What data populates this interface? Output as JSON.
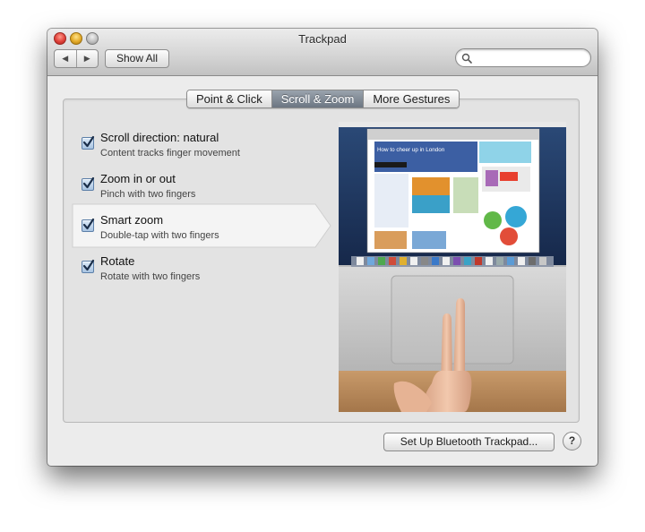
{
  "window": {
    "title": "Trackpad",
    "show_all_label": "Show All",
    "search_placeholder": ""
  },
  "tabs": [
    {
      "label": "Point & Click",
      "active": false
    },
    {
      "label": "Scroll & Zoom",
      "active": true
    },
    {
      "label": "More Gestures",
      "active": false
    }
  ],
  "options": [
    {
      "label": "Scroll direction: natural",
      "description": "Content tracks finger movement",
      "checked": true,
      "selected": false
    },
    {
      "label": "Zoom in or out",
      "description": "Pinch with two fingers",
      "checked": true,
      "selected": false
    },
    {
      "label": "Smart zoom",
      "description": "Double-tap with two fingers",
      "checked": true,
      "selected": true
    },
    {
      "label": "Rotate",
      "description": "Rotate with two fingers",
      "checked": true,
      "selected": false
    }
  ],
  "preview": {
    "headline": "How to cheer up in London"
  },
  "footer": {
    "setup_button": "Set Up Bluetooth Trackpad...",
    "help_label": "?"
  },
  "colors": {
    "active_tab": "#7a838f",
    "checkbox_fill": "#a9c4e2",
    "checkmark": "#1b2f4a"
  }
}
